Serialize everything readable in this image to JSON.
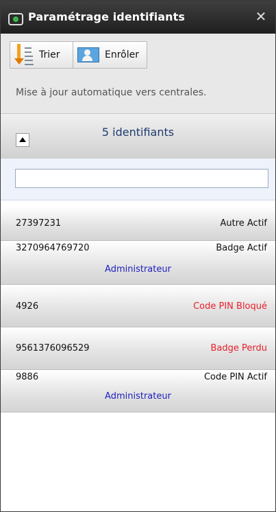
{
  "panel": {
    "title": "Paramétrage identifiants",
    "close_label": "✕"
  },
  "toolbar": {
    "sort_label": "Trier",
    "enrol_label": "Enrôler"
  },
  "info": {
    "text": "Mise à jour automatique vers centrales."
  },
  "list_header": {
    "count_text": "5 identifiants"
  },
  "filter": {
    "value": "",
    "placeholder": ""
  },
  "colors": {
    "status_normal": "#111111",
    "status_alert": "#e8202a",
    "role": "#1f1fbf"
  },
  "identifiers": [
    {
      "number": "27397231",
      "status": "Autre Actif",
      "role": "",
      "alert": false
    },
    {
      "number": "3270964769720",
      "status": "Badge Actif",
      "role": "Administrateur",
      "alert": false
    },
    {
      "number": "4926",
      "status": "Code PIN Bloqué",
      "role": "",
      "alert": true
    },
    {
      "number": "9561376096529",
      "status": "Badge Perdu",
      "role": "",
      "alert": true
    },
    {
      "number": "9886",
      "status": "Code PIN Actif",
      "role": "Administrateur",
      "alert": false
    }
  ]
}
